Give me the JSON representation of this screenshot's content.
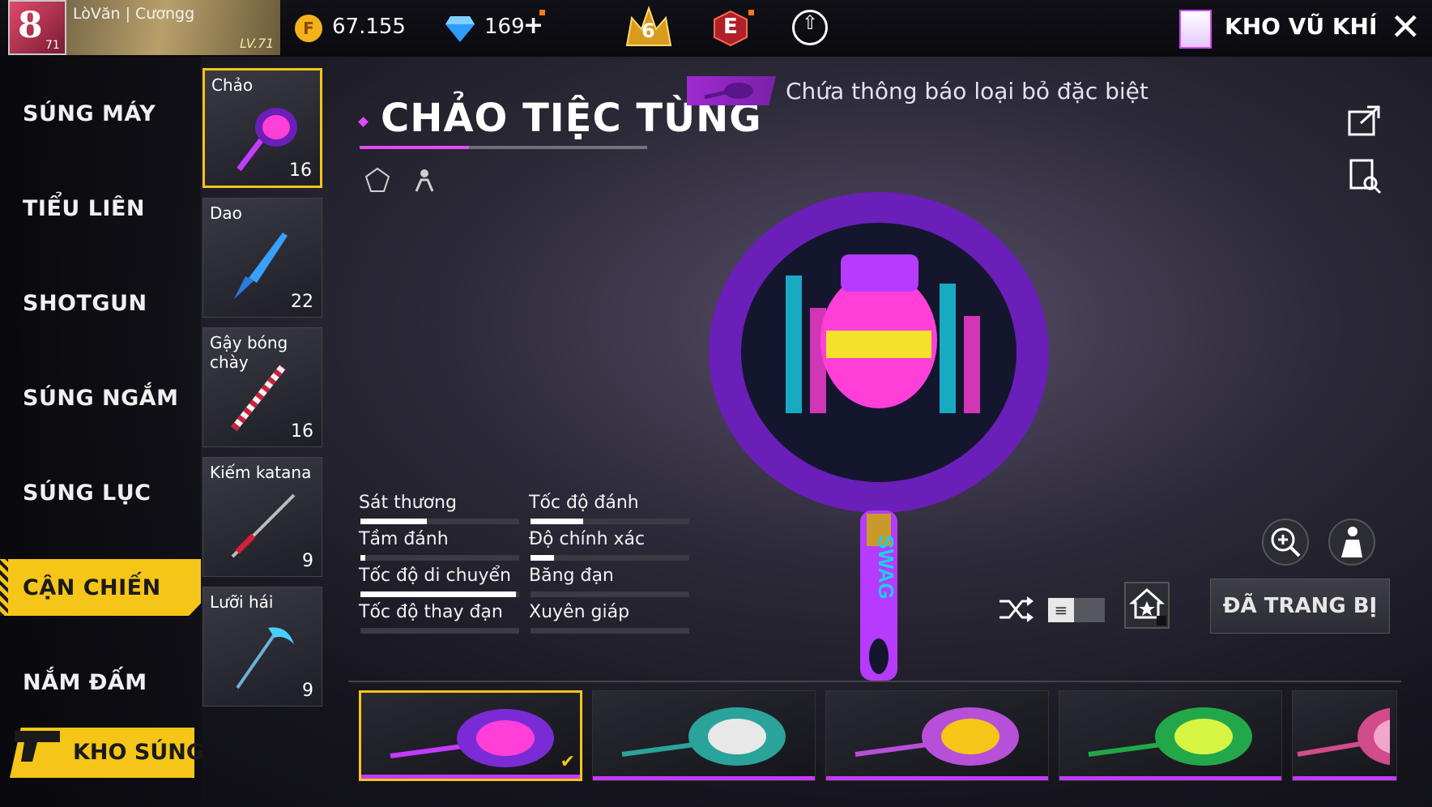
{
  "header": {
    "rank_badge": "8",
    "avatar_level": "71",
    "player_name": "LòVăn | Cươngg",
    "banner_level": "LV.71",
    "gold": "67.155",
    "diamonds": "169",
    "plus": "+",
    "crown_level": "6",
    "elite_label": "E",
    "armory_title": "KHO VŨ KHÍ"
  },
  "categories": [
    {
      "label": "SÚNG MÁY",
      "active": false
    },
    {
      "label": "TIỂU LIÊN",
      "active": false
    },
    {
      "label": "SHOTGUN",
      "active": false
    },
    {
      "label": "SÚNG NGẮM",
      "active": false
    },
    {
      "label": "SÚNG LỤC",
      "active": false
    },
    {
      "label": "CẬN CHIẾN",
      "active": true
    },
    {
      "label": "NẮM ĐẤM",
      "active": false
    }
  ],
  "warehouse_button": "KHO SÚNG",
  "weapon_types": [
    {
      "name": "Chảo",
      "count": "16",
      "selected": true
    },
    {
      "name": "Dao",
      "count": "22",
      "selected": false
    },
    {
      "name": "Gậy bóng chày",
      "count": "16",
      "selected": false
    },
    {
      "name": "Kiếm katana",
      "count": "9",
      "selected": false
    },
    {
      "name": "Lưỡi hái",
      "count": "9",
      "selected": false
    }
  ],
  "item": {
    "title": "CHẢO TIỆC TÙNG",
    "notice": "Chứa thông báo loại bỏ đặc biệt",
    "skin_text": "SWAG"
  },
  "stats": [
    {
      "label": "Sát thương",
      "value": 0.42
    },
    {
      "label": "Tốc độ đánh",
      "value": 0.33
    },
    {
      "label": "Tầm đánh",
      "value": 0.03
    },
    {
      "label": "Độ chính xác",
      "value": 0.15
    },
    {
      "label": "Tốc độ di chuyển",
      "value": 0.98
    },
    {
      "label": "Băng đạn",
      "value": 0
    },
    {
      "label": "Tốc độ thay đạn",
      "value": 0
    },
    {
      "label": "Xuyên giáp",
      "value": 0
    }
  ],
  "controls": {
    "equipped_label": "ĐÃ TRANG BỊ",
    "toggle_glyph": "≡"
  },
  "skins": [
    {
      "selected": true,
      "accent": "#7b2bd6",
      "face": "#ff3fd8"
    },
    {
      "selected": false,
      "accent": "#2aa39b",
      "face": "#e8e8e8"
    },
    {
      "selected": false,
      "accent": "#b74fd8",
      "face": "#f5c518"
    },
    {
      "selected": false,
      "accent": "#22a84a",
      "face": "#d6f542"
    },
    {
      "selected": false,
      "accent": "#d24b8a",
      "face": "#f2a6c9"
    }
  ],
  "colors": {
    "accent_yellow": "#f5c518",
    "accent_purple": "#e24bff",
    "pan_purple": "#6a1fb8"
  }
}
